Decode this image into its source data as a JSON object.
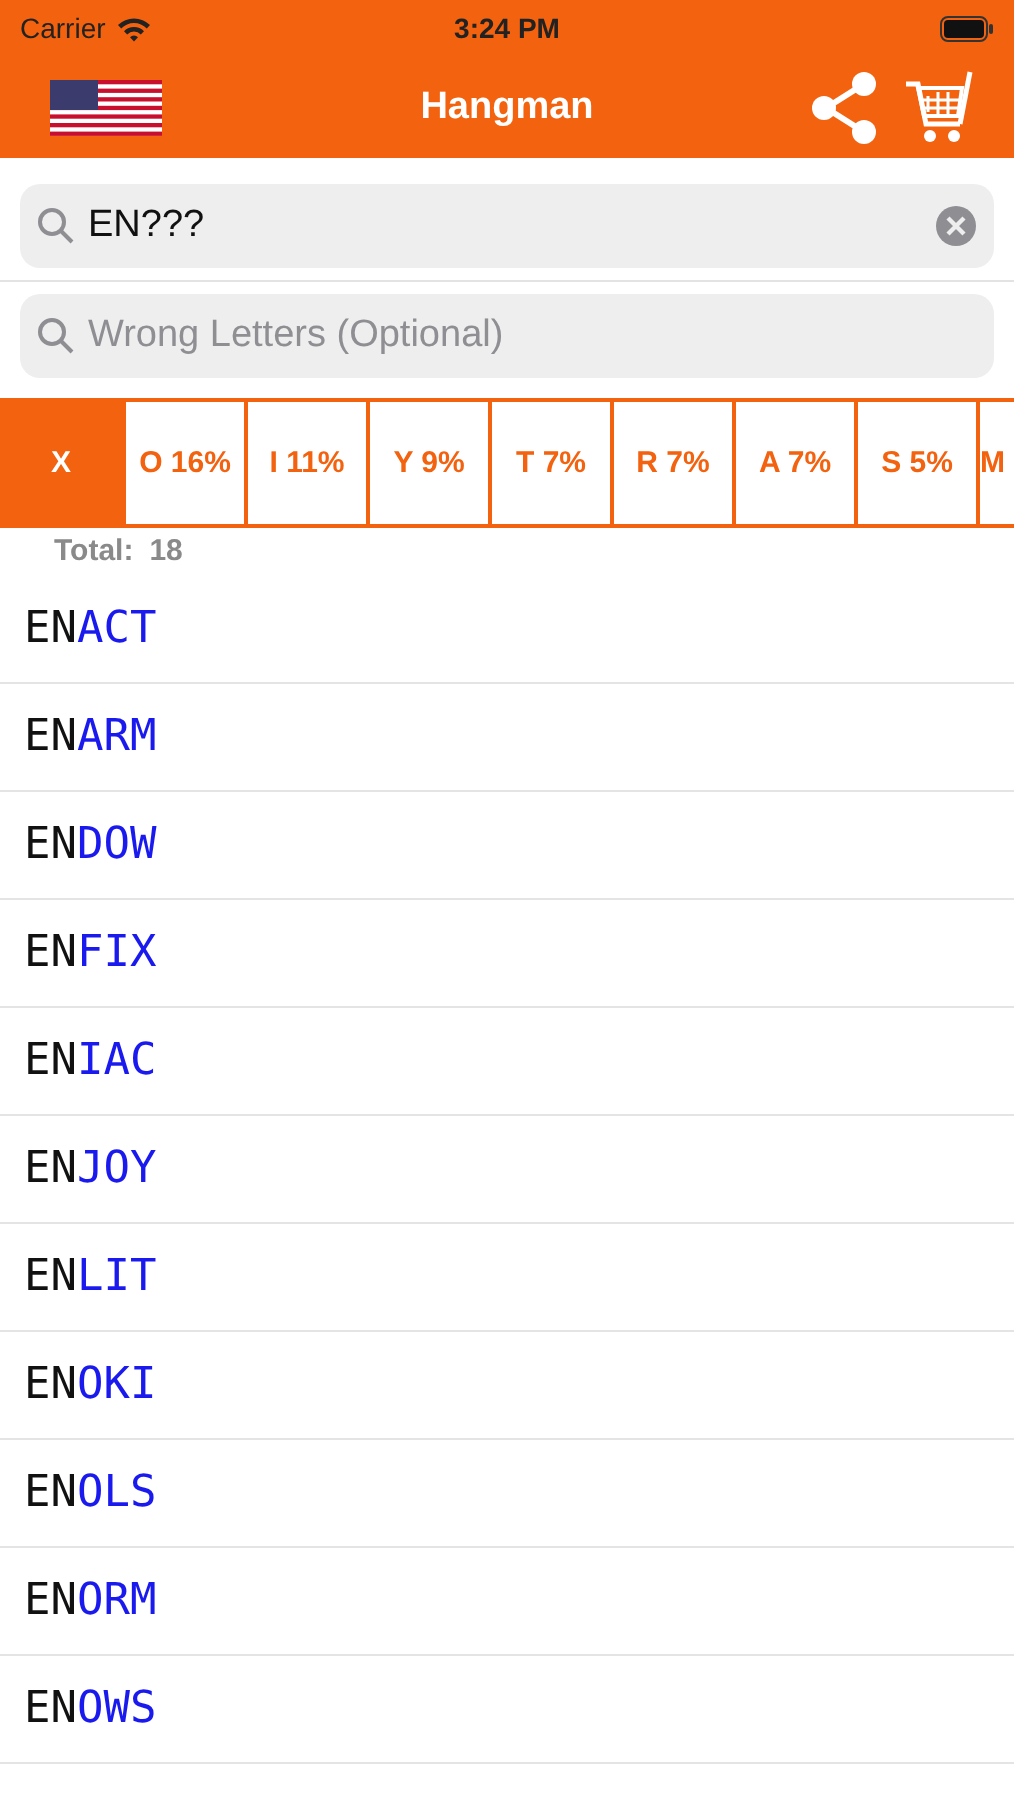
{
  "status_bar": {
    "carrier": "Carrier",
    "time": "3:24 PM"
  },
  "nav": {
    "title": "Hangman"
  },
  "search": {
    "value": "EN???"
  },
  "wrong_letters": {
    "placeholder": "Wrong Letters (Optional)"
  },
  "letter_tabs": [
    {
      "label": "X",
      "selected": true
    },
    {
      "label": "O 16%",
      "selected": false
    },
    {
      "label": "I 11%",
      "selected": false
    },
    {
      "label": "Y 9%",
      "selected": false
    },
    {
      "label": "T 7%",
      "selected": false
    },
    {
      "label": "R 7%",
      "selected": false
    },
    {
      "label": "A 7%",
      "selected": false
    },
    {
      "label": "S 5%",
      "selected": false
    },
    {
      "label": "M",
      "selected": false
    }
  ],
  "total": {
    "label": "Total:",
    "count": "18"
  },
  "words": [
    {
      "prefix": "EN",
      "rest": "ACT"
    },
    {
      "prefix": "EN",
      "rest": "ARM"
    },
    {
      "prefix": "EN",
      "rest": "DOW"
    },
    {
      "prefix": "EN",
      "rest": "FIX"
    },
    {
      "prefix": "EN",
      "rest": "IAC"
    },
    {
      "prefix": "EN",
      "rest": "JOY"
    },
    {
      "prefix": "EN",
      "rest": "LIT"
    },
    {
      "prefix": "EN",
      "rest": "OKI"
    },
    {
      "prefix": "EN",
      "rest": "OLS"
    },
    {
      "prefix": "EN",
      "rest": "ORM"
    },
    {
      "prefix": "EN",
      "rest": "OWS"
    }
  ]
}
